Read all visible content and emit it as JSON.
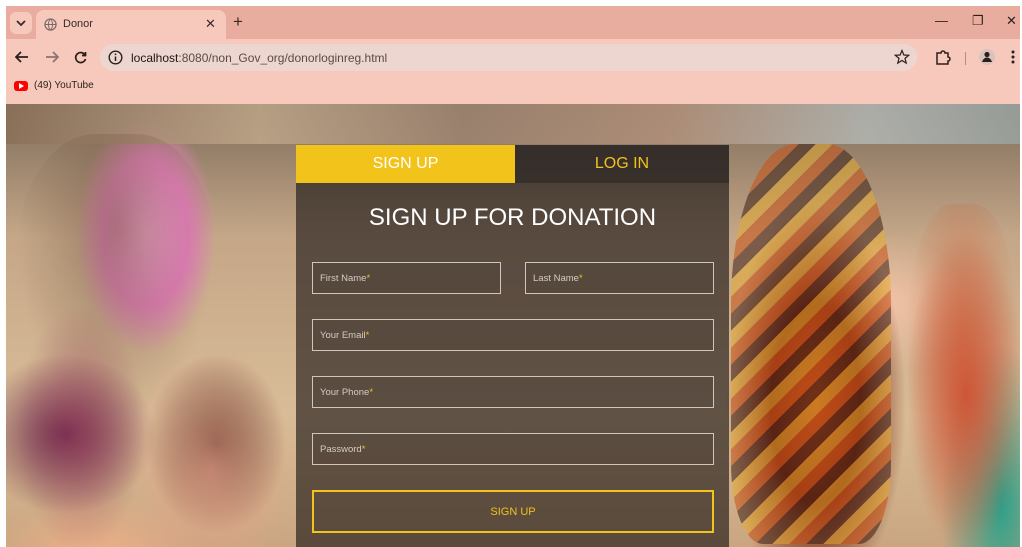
{
  "browser": {
    "tab_title": "Donor",
    "tab_close": "✕",
    "new_tab": "+",
    "url_host": "localhost",
    "url_path": ":8080/non_Gov_org/donorloginreg.html",
    "bookmark_label": "(49) YouTube",
    "window_min": "—",
    "window_max": "❐",
    "window_close": "✕",
    "colors": {
      "frame": "#f6c9bc",
      "tabstrip": "#e8ad9f",
      "omnibox": "#edd6d0"
    }
  },
  "form": {
    "tab_signup": "SIGN UP",
    "tab_login": "LOG IN",
    "title": "SIGN UP FOR DONATION",
    "fields": {
      "first_name": "First Name",
      "last_name": "Last Name",
      "email": "Your Email",
      "phone": "Your Phone",
      "password": "Password"
    },
    "required_mark": "*",
    "submit_label": "SIGN UP",
    "colors": {
      "accent": "#f1c31b",
      "panel": "rgba(22,18,18,0.62)"
    }
  },
  "icons": {
    "tab_list": "chevron-down-icon",
    "favicon": "globe-icon",
    "back": "arrow-left-icon",
    "forward": "arrow-right-icon",
    "reload": "reload-icon",
    "site_info": "info-icon",
    "bookmark": "star-icon",
    "extensions": "puzzle-icon",
    "profile": "profile-icon",
    "menu": "kebab-menu-icon",
    "youtube": "youtube-icon"
  }
}
